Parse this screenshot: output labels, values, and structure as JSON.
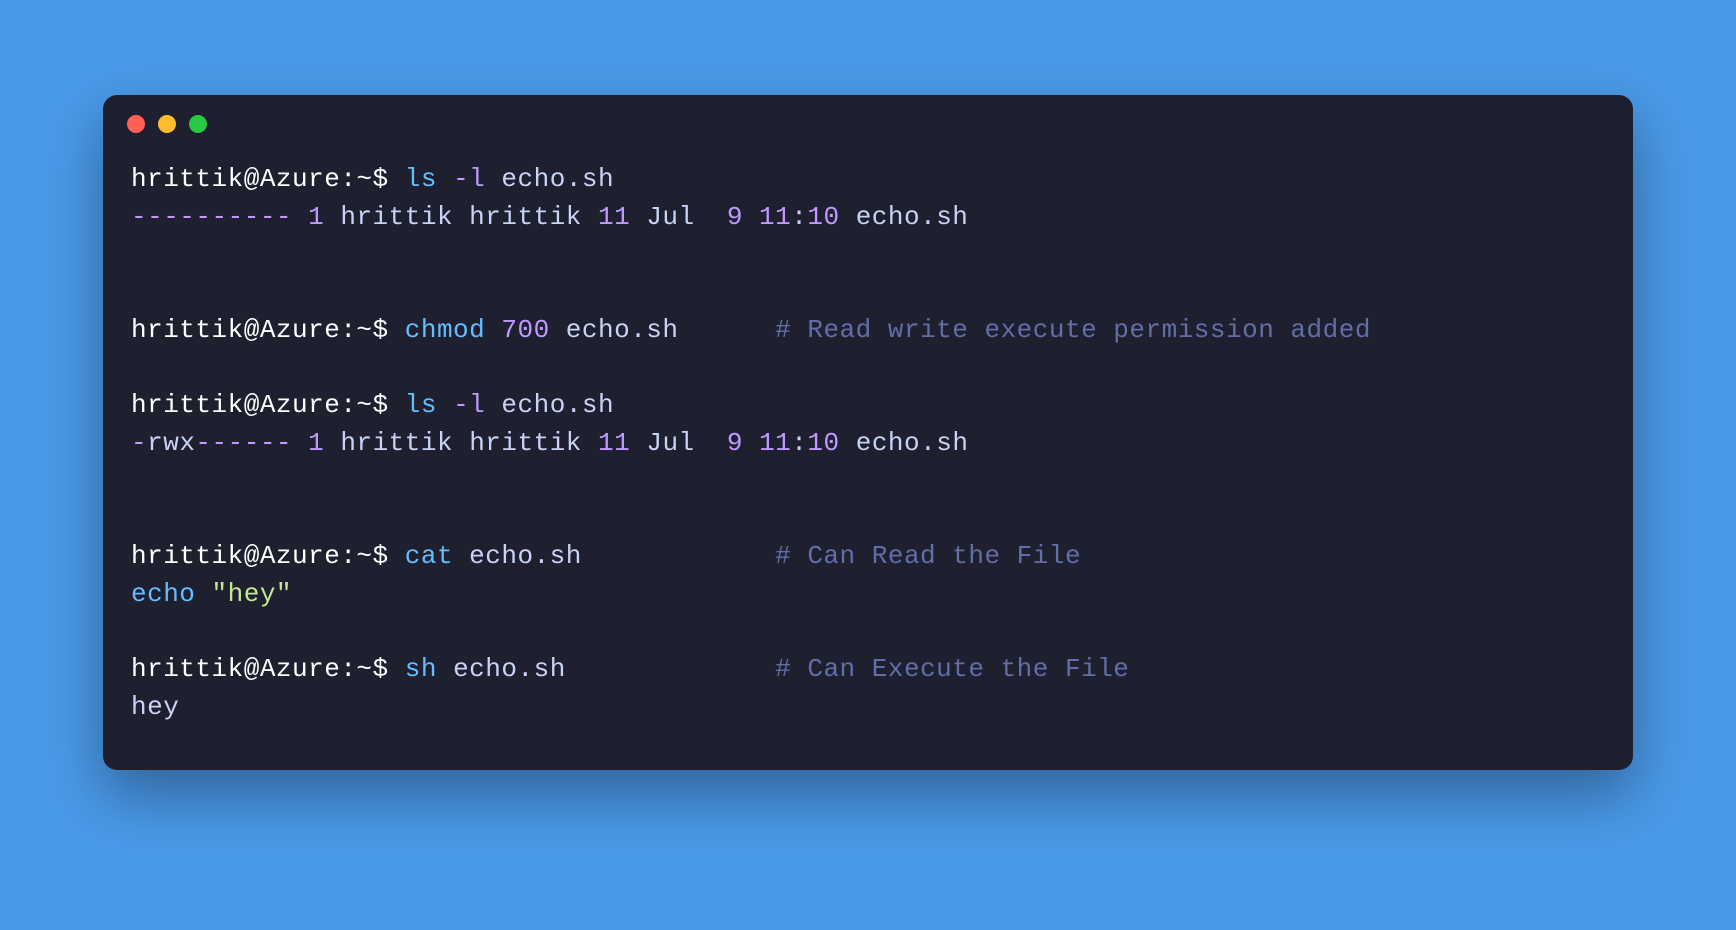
{
  "prompt": "hrittik@Azure:~$ ",
  "cmd1": {
    "command": "ls",
    "flag": "-l",
    "arg": "echo.sh",
    "output_perms": "----------",
    "output_links": " 1",
    "output_rest": " hrittik hrittik ",
    "output_size": "11",
    "output_date1": " Jul  ",
    "output_day": "9",
    "output_time_h": " 11",
    "output_colon": ":",
    "output_time_m": "10",
    "output_file": " echo.sh"
  },
  "cmd2": {
    "command": "chmod",
    "mode": "700",
    "arg": "echo.sh",
    "spacer": "      ",
    "comment": "# Read write execute permission added"
  },
  "cmd3": {
    "command": "ls",
    "flag": "-l",
    "arg": "echo.sh",
    "output_dash": "-",
    "output_rwx": "rwx",
    "output_perms2": "------",
    "output_links": " 1",
    "output_rest": " hrittik hrittik ",
    "output_size": "11",
    "output_date1": " Jul  ",
    "output_day": "9",
    "output_time_h": " 11",
    "output_colon": ":",
    "output_time_m": "10",
    "output_file": " echo.sh"
  },
  "cmd4": {
    "command": "cat",
    "arg": "echo.sh",
    "spacer": "            ",
    "comment": "# Can Read the File",
    "out_echo": "echo ",
    "out_str": "\"hey\""
  },
  "cmd5": {
    "command": "sh",
    "arg": "echo.sh",
    "spacer": "             ",
    "comment": "# Can Execute the File",
    "output": "hey"
  }
}
